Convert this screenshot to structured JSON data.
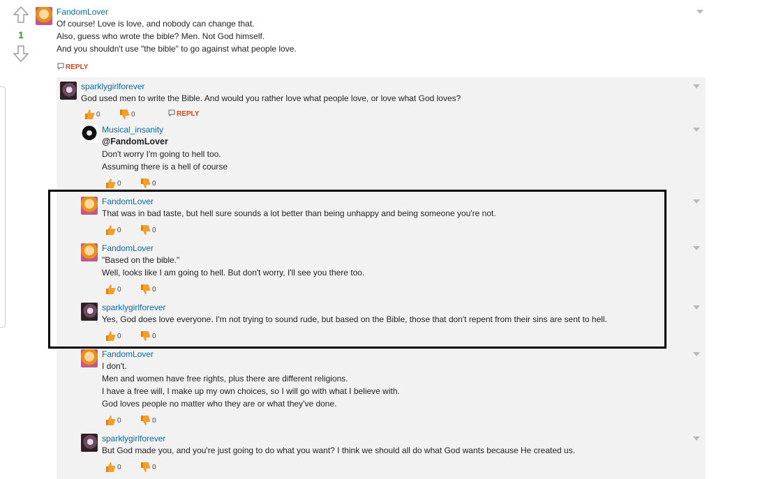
{
  "top": {
    "vote_count": "1",
    "username": "FandomLover",
    "lines": [
      "Of course! Love is love, and nobody can change that.",
      "Also, guess who wrote the bible? Men. Not God himself.",
      "And you shouldn't use \"the bible\" to go against what people love."
    ],
    "reply_label": "REPLY"
  },
  "comments": [
    {
      "username": "sparklygirlforever",
      "lines": [
        "God used men to write the Bible. And would you rather love what people love, or love what God loves?"
      ],
      "up": "0",
      "down": "0",
      "reply_label": "REPLY"
    },
    {
      "username": "Musical_insanity",
      "mention": "@FandomLover",
      "lines": [
        "Don't worry I'm going to hell too.",
        "Assuming there is a hell of course"
      ],
      "up": "0",
      "down": "0"
    },
    {
      "username": "FandomLover",
      "lines": [
        "That was in bad taste, but hell sure sounds a lot better than being unhappy and being someone you're not."
      ],
      "up": "0",
      "down": "0"
    },
    {
      "username": "FandomLover",
      "lines": [
        "\"Based on the bible.\"",
        "Well, looks like I am going to hell. But don't worry, I'll see you there too."
      ],
      "up": "0",
      "down": "0"
    },
    {
      "username": "sparklygirlforever",
      "lines": [
        "Yes, God does love everyone. I'm not trying to sound rude, but based on the Bible, those that don't repent from their sins are sent to hell."
      ],
      "up": "0",
      "down": "0"
    },
    {
      "username": "FandomLover",
      "lines": [
        "I don't.",
        "Men and women have free rights, plus there are different religions.",
        "I have a free will, I make up my own choices, so I will go with what I believe with.",
        "God loves people no matter who they are or what they've done."
      ],
      "up": "0",
      "down": "0"
    },
    {
      "username": "sparklygirlforever",
      "lines": [
        "But God made you, and you're just going to do what you want? I think we should all do what God wants because He created us."
      ],
      "up": "0",
      "down": "0"
    }
  ],
  "colors": {
    "username": "#0b6aa2",
    "reply": "#d3441f",
    "votes": "#3a8f2e",
    "thumbs": "#f2a02b"
  }
}
